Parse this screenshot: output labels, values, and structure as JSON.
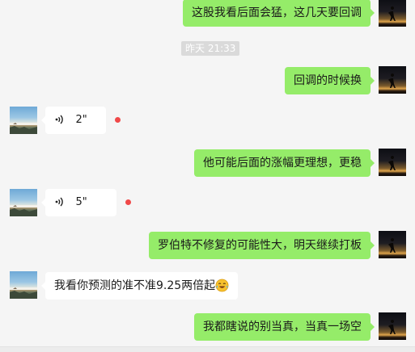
{
  "messages": {
    "m1": {
      "text": "这股我看后面会猛，这几天要回调"
    },
    "timestamp": "昨天 21:33",
    "m2": {
      "text": "回调的时候换"
    },
    "m3": {
      "voice_length": "2\""
    },
    "m4": {
      "text": "他可能后面的涨幅更理想，更稳"
    },
    "m5": {
      "voice_length": "5\""
    },
    "m6": {
      "text": "罗伯特不修复的可能性大，明天继续打板"
    },
    "m7": {
      "text": "我看你预测的准不准9.25两倍起",
      "emoji": "laughing-crying-emoji"
    },
    "m8": {
      "text": "我都瞎说的别当真，当真一场空"
    }
  },
  "colors": {
    "outgoing_bubble": "#95ec69",
    "incoming_bubble": "#ffffff",
    "background": "#f5f5f5",
    "unread_dot": "#f04848",
    "timestamp_bg": "#dadada"
  },
  "icons": {
    "voice": "voice-wave-icon",
    "unread": "unread-dot"
  }
}
